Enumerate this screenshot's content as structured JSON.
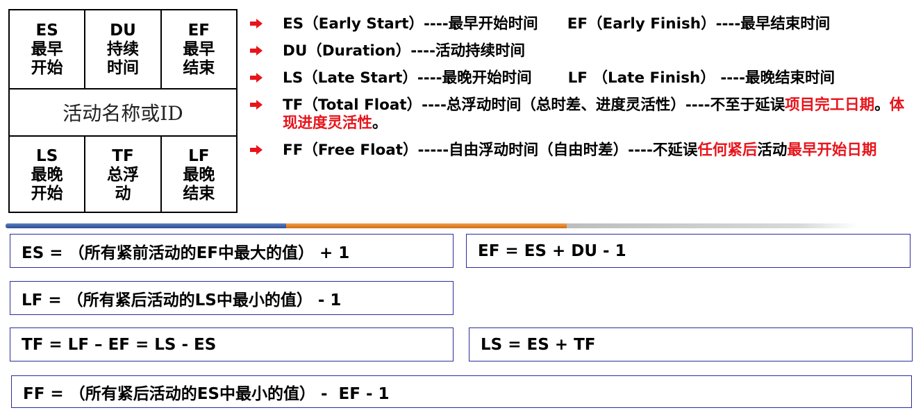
{
  "node": {
    "top": [
      {
        "abbr": "ES",
        "line1": "最早",
        "line2": "开始"
      },
      {
        "abbr": "DU",
        "line1": "持续",
        "line2": "时间"
      },
      {
        "abbr": "EF",
        "line1": "最早",
        "line2": "结束"
      }
    ],
    "middle": "活动名称或ID",
    "bottom": [
      {
        "abbr": "LS",
        "line1": "最晚",
        "line2": "开始"
      },
      {
        "abbr": "TF",
        "line1": "总浮",
        "line2": "动"
      },
      {
        "abbr": "LF",
        "line1": "最晚",
        "line2": "结束"
      }
    ]
  },
  "definitions": {
    "es": "ES（Early Start）----最早开始时间",
    "ef": "EF（Early Finish）----最早结束时间",
    "du": "DU（Duration）----活动持续时间",
    "ls": "LS（Late Start）----最晚开始时间",
    "lf": "LF （Late Finish） ----最晚结束时间",
    "tf_main": "TF（Total Float）----总浮动时间（总时差、进度灵活性）----不至于延误",
    "tf_red1": "项目完工日期",
    "tf_sep": "。",
    "tf_red2": "体现进度灵活性",
    "tf_end": "。",
    "ff_main": "FF（Free Float）-----自由浮动时间（自由时差）----不延误",
    "ff_red1": "任何紧后",
    "ff_mid": "活动",
    "ff_red2": "最早开始日期"
  },
  "formulas": {
    "es": "ES = （所有紧前活动的EF中最大的值） + 1",
    "ef": "EF = ES + DU - 1",
    "lf": "LF = （所有紧后活动的LS中最小的值） - 1",
    "tf": "TF = LF – EF = LS - ES",
    "ls": "LS = ES + TF",
    "ff": "FF = （所有紧后活动的ES中最小的值） -  EF - 1"
  },
  "colors": {
    "bullet": "#e8141b",
    "highlight": "#e8141b",
    "box_border": "#2b2b9a",
    "divider": [
      "#2c4f96",
      "#d26b14",
      "#cccccc"
    ]
  },
  "icons": {
    "bullet": "red-arrow-bullet-icon"
  }
}
